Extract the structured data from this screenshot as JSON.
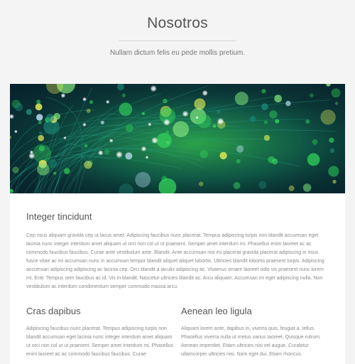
{
  "header": {
    "title": "Nosotros",
    "subtitle": "Nullam dictum felis eu pede mollis pretium."
  },
  "hero": {
    "description_icon": "fiber-optic-lights-image",
    "colors": {
      "dark": "#06202a",
      "teal": "#1c8a7a",
      "green": "#32d25a",
      "yellow": "#e8f05a"
    }
  },
  "intro": {
    "heading": "Integer tincidunt",
    "text": "Cep risus aliquam gravida cep ut lacus amet. Adipiscing faucibus nunc placerat. Tempus adipiscing turpis non blandit accumsan eget lacinia nunc integer interdum amet aliquam ut orci non col ut ut praesent. Semper amet interdum mi. Phasellus enim laoreet ac ac commodo faucibus faucibus. Curae ante vestibulum ante. Blandit. Ante accumsan nisi eu placerat gravida placerat adipiscing in risus fusce vitae ac mi accumsan nunc in accumsan tempor blandit aliquet aliquet lobortis. Ultricies blandit lobortis praesent turpis. Adipiscing accumsan adipiscing adipiscing ac lacinia cep. Orci blandit a iaculis adipiscing ac. Vivamus ornare laoreet odio vis praesent nunc lorem mi. Erat. Tempus sem faucibus ac id. Vis in blandit. Nascetur ultricies blandit ac. Arcu aliquam. Accumsan mi eget adipiscing nulla. Non vestibulum ac interdum condimentum semper commodo massa arcu."
  },
  "columns": [
    {
      "heading": "Cras dapibus",
      "text": "Adipiscing faucibus nunc placerat. Tempus adipiscing turpis non blandit accumsan eget lacinia nunc integer interdum amet aliquam ut orci non col ut ut praesent. Semper amet interdum mi. Phasellus enim laoreet ac ac commodo faucibus faucibus. Curae"
    },
    {
      "heading": "Aenean leo ligula",
      "text": "Aliquam lorem ante, dapibus in, viverra quis, feugiat a, tellus. Phasellus viverra nulla ut metus varius laoreet. Quisque rutrum. Aenean imperdiet. Etiam ultricies nisi vel augue. Curabitur ullamcorper ultricies nisi. Nam eget dui. Etiam rhoncus."
    }
  ]
}
